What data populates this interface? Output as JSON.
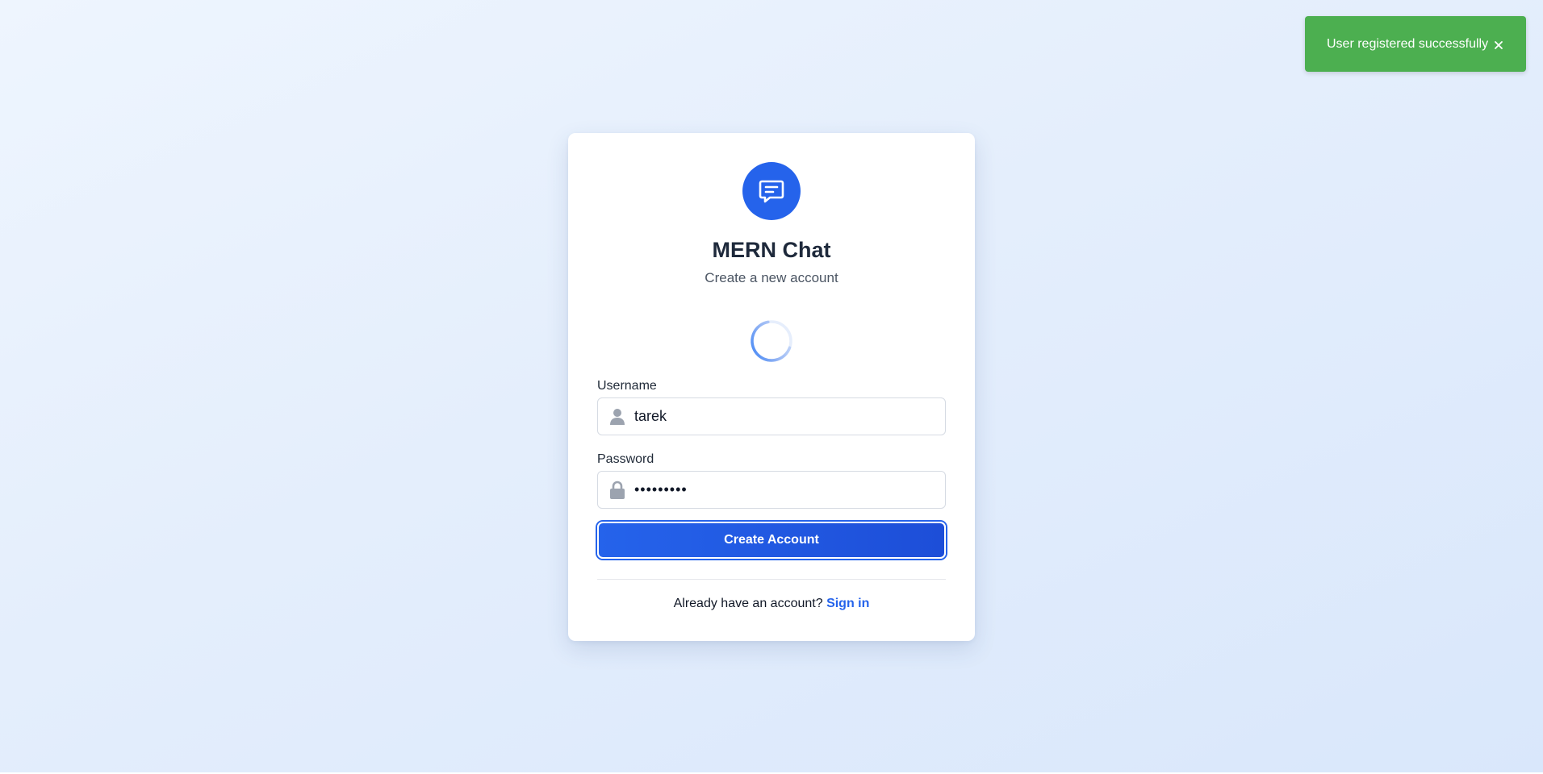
{
  "toast": {
    "message": "User registered successfully",
    "close_icon": "close-icon",
    "color": "#4caf50"
  },
  "brand": {
    "icon": "chat-bubble-icon",
    "title": "MERN Chat",
    "subtitle": "Create a new account",
    "accent": "#2563eb"
  },
  "form": {
    "username": {
      "label": "Username",
      "icon": "user-icon",
      "value": "tarek"
    },
    "password": {
      "label": "Password",
      "icon": "lock-icon",
      "value": "•••••••••"
    },
    "submit_label": "Create Account"
  },
  "footer": {
    "prompt": "Already have an account?",
    "link_label": "Sign in"
  },
  "status": {
    "loading": true
  }
}
